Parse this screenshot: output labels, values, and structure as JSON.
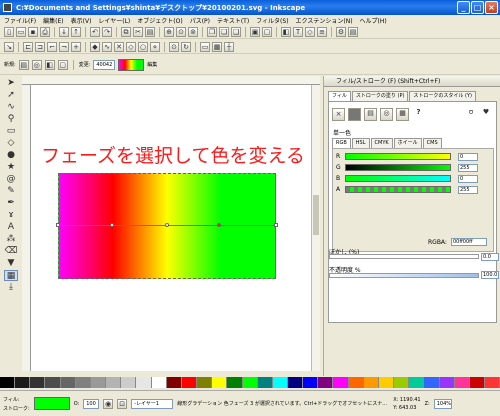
{
  "window": {
    "title": "C:¥Documents and Settings¥shinta¥デスクトップ¥20100201.svg - Inkscape"
  },
  "menu": [
    "ファイル(F)",
    "編集(E)",
    "表示(V)",
    "レイヤー(L)",
    "オブジェクト(O)",
    "パス(P)",
    "テキスト(T)",
    "フィルタ(S)",
    "エクステンション(N)",
    "ヘルプ(H)"
  ],
  "controls": {
    "new_label": "新規:",
    "stops_label": "変更:",
    "stop_value": "40042",
    "edit_label": "編集"
  },
  "canvas": {
    "heading": "フェーズを選択して色を変える"
  },
  "panel": {
    "title": "フィル/ストローク (F) (Shift+Ctrl+F)",
    "tabs": [
      "フィル",
      "ストロークの塗り (P)",
      "ストロークのスタイル (Y)"
    ],
    "mode_label": "単一色",
    "color_tabs": [
      "RGB",
      "HSL",
      "CMYK",
      "ホイール",
      "CMS"
    ],
    "channels": [
      {
        "label": "R",
        "value": "0"
      },
      {
        "label": "G",
        "value": "255"
      },
      {
        "label": "B",
        "value": "0"
      },
      {
        "label": "A",
        "value": "255"
      }
    ],
    "rgba_label": "RGBA:",
    "rgba_value": "00ff00ff",
    "blur_label": "ぼかし (%)",
    "blur_value": "0.0",
    "opacity_label": "不透明度 %",
    "opacity_value": "100.0"
  },
  "palette": [
    "#000000",
    "#1a1a1a",
    "#333333",
    "#4d4d4d",
    "#666666",
    "#808080",
    "#999999",
    "#b3b3b3",
    "#cccccc",
    "#e6e6e6",
    "#ffffff",
    "#800000",
    "#ff0000",
    "#808000",
    "#ffff00",
    "#008000",
    "#00ff00",
    "#008080",
    "#00ffff",
    "#000080",
    "#0000ff",
    "#800080",
    "#ff00ff",
    "#ff6600",
    "#ff9900",
    "#ffcc00",
    "#99cc00",
    "#00cc99",
    "#3366ff",
    "#9933ff",
    "#ff3399",
    "#cc0000",
    "#ff3333"
  ],
  "status": {
    "fill_label": "フィル:",
    "stroke_label": "ストローク:",
    "fill_color": "#00ff00",
    "opacity_label": "O:",
    "opacity_value": "100",
    "layer_label": "-レイヤー1",
    "message": "線形グラデーション 色フェーズ 3 が選択されています。Ctrl+ドラッグでオフセットにスナップ、Ctrl+Alt+クリックで削除",
    "x": "X: 1190.41",
    "y": "Y: 643.03",
    "z_label": "Z:",
    "zoom": "104%"
  }
}
